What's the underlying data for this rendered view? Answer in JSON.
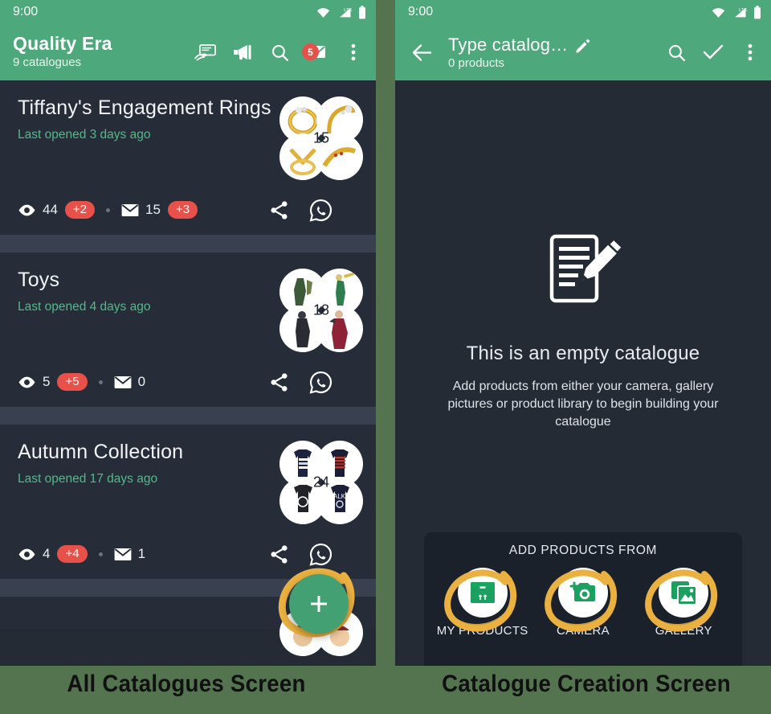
{
  "left_screen": {
    "status_bar": {
      "time": "9:00",
      "icons": [
        "wifi-icon",
        "lte-signal-icon",
        "battery-icon"
      ]
    },
    "app_bar": {
      "title": "Quality Era",
      "subtitle": "9 catalogues",
      "actions": [
        {
          "name": "hand-card-icon",
          "label": "Visiting card"
        },
        {
          "name": "megaphone-icon",
          "label": "Broadcast"
        },
        {
          "name": "search-icon",
          "label": "Search"
        },
        {
          "name": "inbox-icon",
          "label": "Inbox",
          "badge": "5"
        },
        {
          "name": "overflow-menu-icon",
          "label": "More options"
        }
      ]
    },
    "catalogues": [
      {
        "title": "Tiffany's Engagement Rings",
        "last_opened": "Last opened 3 days ago",
        "product_count": "15",
        "views": "44",
        "views_delta": "+2",
        "enquiries": "15",
        "enquiries_delta": "+3",
        "thumb_kind": "rings"
      },
      {
        "title": "Toys",
        "last_opened": "Last opened 4 days ago",
        "product_count": "18",
        "views": "5",
        "views_delta": "+5",
        "enquiries": "0",
        "enquiries_delta": "",
        "thumb_kind": "figures"
      },
      {
        "title": "Autumn Collection",
        "last_opened": "Last opened 17 days ago",
        "product_count": "24",
        "views": "4",
        "views_delta": "+4",
        "enquiries": "1",
        "enquiries_delta": "",
        "thumb_kind": "shirts"
      }
    ],
    "row_actions": [
      {
        "name": "share-icon",
        "label": "Share"
      },
      {
        "name": "whatsapp-icon",
        "label": "WhatsApp"
      }
    ],
    "fab": {
      "name": "add-catalogue-fab",
      "label": "+"
    }
  },
  "right_screen": {
    "status_bar": {
      "time": "9:00",
      "icons": [
        "wifi-icon",
        "lte-signal-icon",
        "battery-icon"
      ]
    },
    "app_bar": {
      "title": "Type catalog…",
      "subtitle": "0 products",
      "back": "back-arrow-icon",
      "edit": "pencil-icon",
      "actions": [
        {
          "name": "search-icon",
          "label": "Search"
        },
        {
          "name": "check-icon",
          "label": "Done"
        },
        {
          "name": "overflow-menu-icon",
          "label": "More options"
        }
      ]
    },
    "empty_state": {
      "illustration": "document-pencil-icon",
      "title": "This is an empty catalogue",
      "description": "Add products from either your camera, gallery pictures or product library to begin building your catalogue"
    },
    "add_sheet": {
      "title": "ADD PRODUCTS FROM",
      "options": [
        {
          "label": "MY PRODUCTS",
          "icon": "box-icon"
        },
        {
          "label": "CAMERA",
          "icon": "camera-plus-icon"
        },
        {
          "label": "GALLERY",
          "icon": "photo-library-icon"
        }
      ]
    }
  },
  "captions": {
    "left": "All Catalogues Screen",
    "right": "Catalogue Creation Screen"
  },
  "colors": {
    "green_bar": "#4da87c",
    "page_background": "#53744f",
    "card_background": "#262d38",
    "screen_background": "#242b35",
    "separator": "#394050",
    "accent_red": "#e8504a",
    "meta_green": "#54b98a",
    "scribble_gold": "#eab140"
  }
}
